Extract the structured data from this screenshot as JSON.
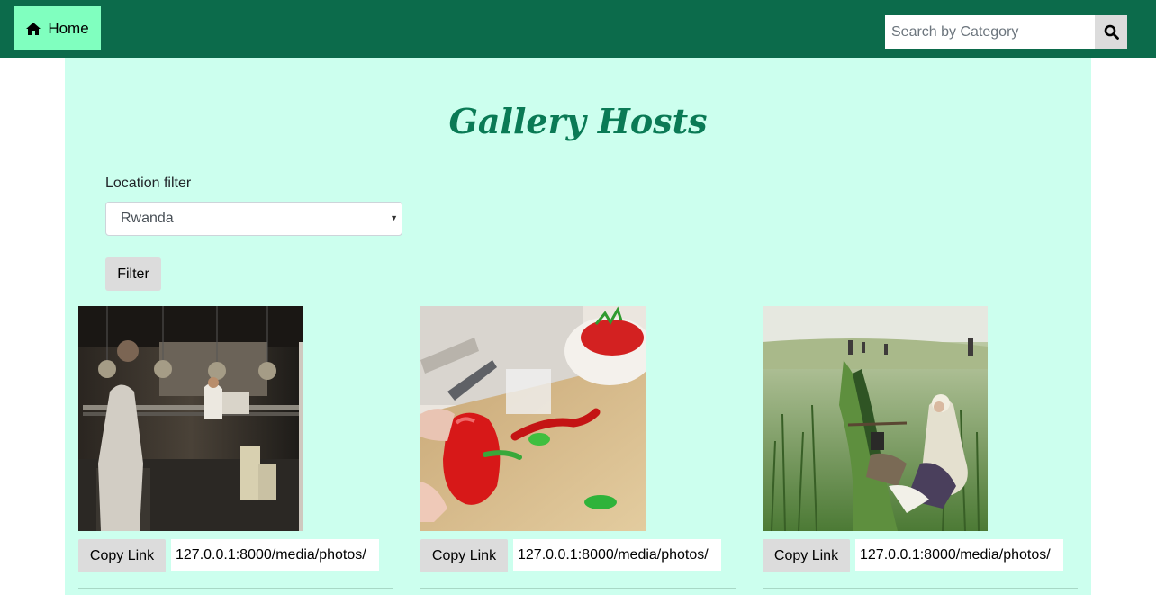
{
  "navbar": {
    "home_label": "Home",
    "home_icon": "home-icon",
    "search_placeholder": "Search by Category",
    "search_icon": "search-icon",
    "bg_color": "#0c6b4b",
    "home_bg_color": "#80ffbf"
  },
  "main": {
    "title": "Gallery Hosts",
    "filter_label": "Location filter",
    "selected_location": "Rwanda",
    "filter_button": "Filter",
    "bg_color": "#ccffee"
  },
  "cards": [
    {
      "copy_label": "Copy Link",
      "link": "127.0.0.1:8000/media/photos/",
      "image": "kitchen-photo"
    },
    {
      "copy_label": "Copy Link",
      "link": "127.0.0.1:8000/media/photos/",
      "image": "peppers-photo"
    },
    {
      "copy_label": "Copy Link",
      "link": "127.0.0.1:8000/media/photos/",
      "image": "meadow-painting"
    }
  ]
}
